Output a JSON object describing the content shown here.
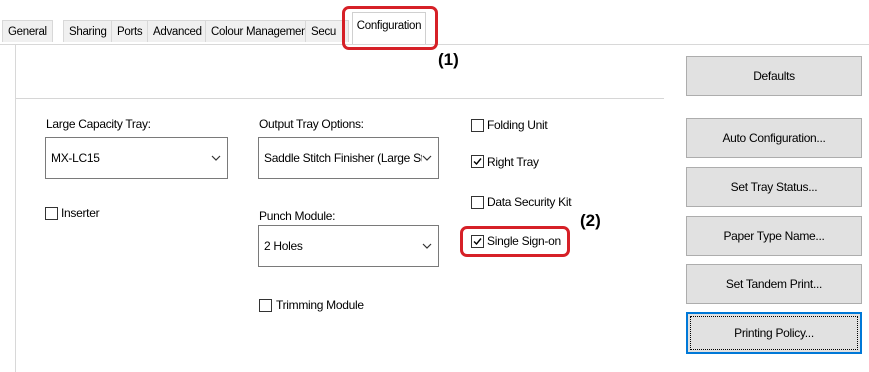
{
  "tabs": {
    "general": "General",
    "sharing": "Sharing",
    "ports": "Ports",
    "advanced": "Advanced",
    "colour": "Colour Management",
    "security": "Secu",
    "configuration": "Configuration"
  },
  "callouts": {
    "one": "(1)",
    "two": "(2)"
  },
  "buttons": {
    "defaults": "Defaults",
    "auto_configuration": "Auto Configuration...",
    "set_tray_status": "Set Tray Status...",
    "paper_type_name": "Paper Type Name...",
    "set_tandem_print": "Set Tandem Print...",
    "printing_policy": "Printing Policy..."
  },
  "large_capacity_tray": {
    "label": "Large Capacity Tray:",
    "value": "MX-LC15"
  },
  "output_tray": {
    "label": "Output Tray Options:",
    "value": "Saddle Stitch Finisher (Large Stack"
  },
  "punch_module": {
    "label": "Punch Module:",
    "value": "2 Holes"
  },
  "checkboxes": {
    "inserter": {
      "label": "Inserter",
      "checked": false
    },
    "trimming_module": {
      "label": "Trimming Module",
      "checked": false
    },
    "folding_unit": {
      "label": "Folding Unit",
      "checked": false
    },
    "right_tray": {
      "label": "Right Tray",
      "checked": true
    },
    "data_security_kit": {
      "label": "Data Security Kit",
      "checked": false
    },
    "single_sign_on": {
      "label": "Single Sign-on",
      "checked": true
    }
  },
  "colors": {
    "highlight": "#d62027",
    "focus_blue": "#0078d7"
  }
}
